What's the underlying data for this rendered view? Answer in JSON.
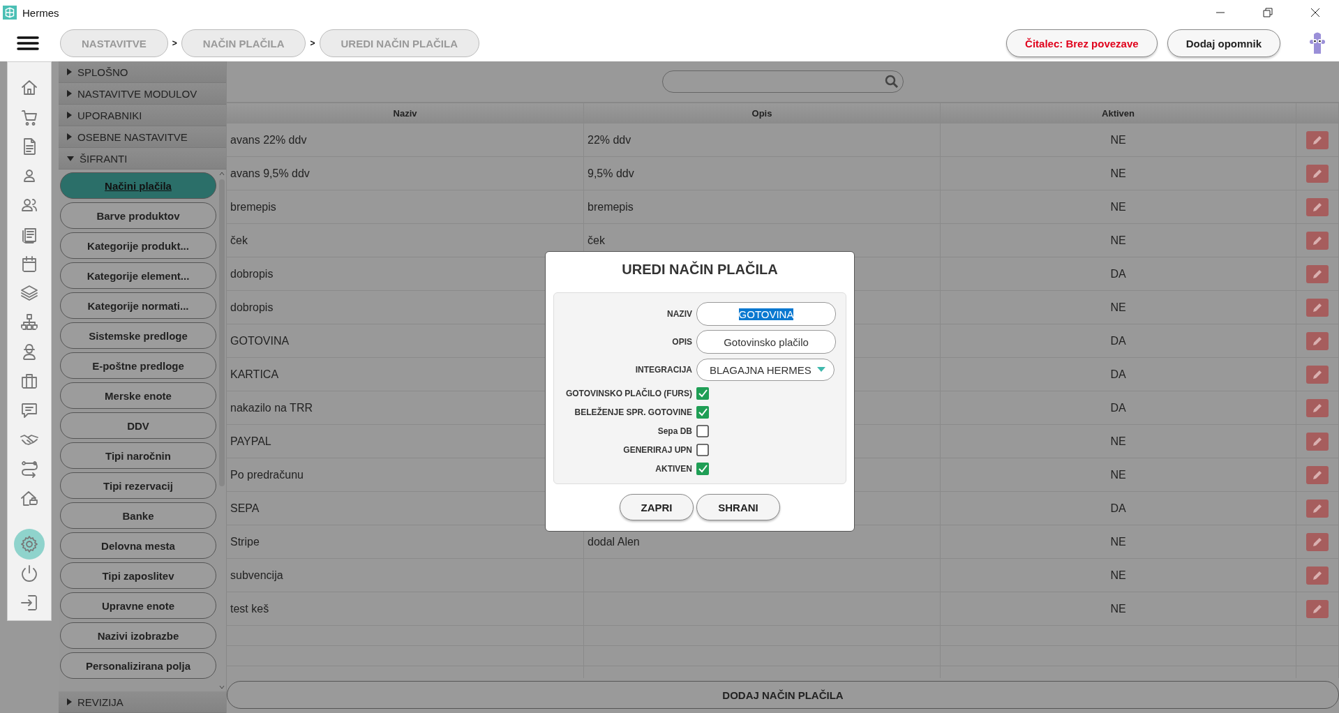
{
  "window": {
    "title": "Hermes"
  },
  "breadcrumbs": [
    {
      "label": "NASTAVITVE"
    },
    {
      "label": "NAČIN PLAČILA"
    },
    {
      "label": "UREDI NAČIN PLAČILA"
    }
  ],
  "breadcrumb_separator": ">",
  "header_buttons": [
    {
      "label": "Čitalec: Brez povezave",
      "kind": "alert"
    },
    {
      "label": "Dodaj opomnik",
      "kind": "normal"
    }
  ],
  "nav_icons": [
    {
      "selected": false
    },
    {
      "selected": false
    },
    {
      "selected": false
    },
    {
      "selected": false
    },
    {
      "selected": false
    },
    {
      "selected": false
    },
    {
      "selected": false
    },
    {
      "selected": false
    },
    {
      "selected": false
    },
    {
      "selected": false
    },
    {
      "selected": false
    },
    {
      "selected": false
    },
    {
      "selected": false
    },
    {
      "selected": false
    },
    {
      "selected": false
    },
    {
      "selected": true
    },
    {
      "selected": false
    },
    {
      "selected": false
    }
  ],
  "sidebar": {
    "sections": [
      {
        "label": "SPLOŠNO",
        "expanded": false
      },
      {
        "label": "NASTAVITVE MODULOV",
        "expanded": false
      },
      {
        "label": "UPORABNIKI",
        "expanded": false
      },
      {
        "label": "OSEBNE NASTAVITVE",
        "expanded": false
      },
      {
        "label": "ŠIFRANTI",
        "expanded": true
      }
    ],
    "items": [
      {
        "label": "Načini plačila",
        "selected": true
      },
      {
        "label": "Barve produktov",
        "selected": false
      },
      {
        "label": "Kategorije produkt...",
        "selected": false
      },
      {
        "label": "Kategorije element...",
        "selected": false
      },
      {
        "label": "Kategorije normati...",
        "selected": false
      },
      {
        "label": "Sistemske predloge",
        "selected": false
      },
      {
        "label": "E-poštne predloge",
        "selected": false
      },
      {
        "label": "Merske enote",
        "selected": false
      },
      {
        "label": "DDV",
        "selected": false
      },
      {
        "label": "Tipi naročnin",
        "selected": false
      },
      {
        "label": "Tipi rezervacij",
        "selected": false
      },
      {
        "label": "Banke",
        "selected": false
      },
      {
        "label": "Delovna mesta",
        "selected": false
      },
      {
        "label": "Tipi zaposlitev",
        "selected": false
      },
      {
        "label": "Upravne enote",
        "selected": false
      },
      {
        "label": "Nazivi izobrazbe",
        "selected": false
      },
      {
        "label": "Personalizirana polja",
        "selected": false
      }
    ],
    "footer_section": {
      "label": "REVIZIJA",
      "expanded": false
    }
  },
  "table": {
    "columns": [
      "Naziv",
      "Opis",
      "Aktiven"
    ],
    "rows": [
      {
        "naziv": "avans 22% ddv",
        "opis": "22% ddv",
        "aktiven": "NE"
      },
      {
        "naziv": "avans 9,5% ddv",
        "opis": "9,5% ddv",
        "aktiven": "NE"
      },
      {
        "naziv": "bremepis",
        "opis": "bremepis",
        "aktiven": "NE"
      },
      {
        "naziv": "ček",
        "opis": "ček",
        "aktiven": "NE"
      },
      {
        "naziv": "dobropis",
        "aktiven": "DA"
      },
      {
        "naziv": "dobropis",
        "aktiven": "NE"
      },
      {
        "naziv": "GOTOVINA",
        "aktiven": "DA"
      },
      {
        "naziv": "KARTICA",
        "aktiven": "DA"
      },
      {
        "naziv": "nakazilo na TRR",
        "aktiven": "DA"
      },
      {
        "naziv": "PAYPAL",
        "aktiven": "NE"
      },
      {
        "naziv": "Po predračunu",
        "aktiven": "NE"
      },
      {
        "naziv": "SEPA",
        "aktiven": "DA"
      },
      {
        "naziv": "Stripe",
        "opis": "dodal Alen",
        "aktiven": "NE"
      },
      {
        "naziv": "subvencija",
        "aktiven": "NE"
      },
      {
        "naziv": "test keš",
        "aktiven": "NE"
      }
    ]
  },
  "add_button": {
    "label": "DODAJ NAČIN PLAČILA"
  },
  "dialog": {
    "title": "UREDI NAČIN PLAČILA",
    "fields": [
      {
        "label": "NAZIV",
        "value": "GOTOVINA",
        "value_selected": true,
        "kind": "text"
      },
      {
        "label": "OPIS",
        "value": "Gotovinsko plačilo",
        "kind": "text"
      },
      {
        "label": "INTEGRACIJA",
        "value": "BLAGAJNA HERMES",
        "kind": "dropdown"
      }
    ],
    "checkboxes": [
      {
        "label": "GOTOVINSKO PLAČILO (FURS)",
        "checked": true
      },
      {
        "label": "BELEŽENJE SPR. GOTOVINE",
        "checked": true
      },
      {
        "label": "Sepa DB",
        "checked": false
      },
      {
        "label": "GENERIRAJ UPN",
        "checked": false
      },
      {
        "label": "AKTIVEN",
        "checked": true
      }
    ],
    "buttons": [
      {
        "label": "ZAPRI"
      },
      {
        "label": "SHRANI"
      }
    ]
  }
}
